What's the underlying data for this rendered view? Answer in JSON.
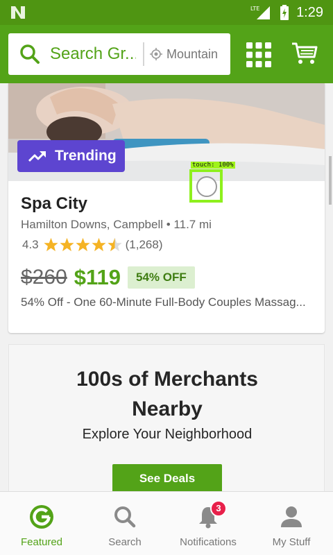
{
  "status_bar": {
    "network": "LTE",
    "time": "1:29"
  },
  "header": {
    "search_placeholder": "Search Gr...",
    "location": "Mountain"
  },
  "deal": {
    "badge": "Trending",
    "title": "Spa City",
    "location": "Hamilton Downs, Campbell • 11.7 mi",
    "rating": "4.3",
    "stars": 4.3,
    "review_count": "(1,268)",
    "old_price": "$260",
    "new_price": "$119",
    "discount": "54% OFF",
    "description": "54% Off - One 60-Minute Full-Body Couples Massag..."
  },
  "touch_overlay": {
    "label": "touch: 100%"
  },
  "merchants": {
    "heading_line1": "100s of Merchants",
    "heading_line2": "Nearby",
    "subheading": "Explore Your Neighborhood",
    "button": "See Deals"
  },
  "bottom_nav": {
    "items": [
      {
        "label": "Featured",
        "icon": "groupon-g-icon",
        "active": true
      },
      {
        "label": "Search",
        "icon": "search-icon",
        "active": false
      },
      {
        "label": "Notifications",
        "icon": "bell-icon",
        "active": false
      },
      {
        "label": "My Stuff",
        "icon": "person-icon",
        "active": false
      }
    ],
    "notification_count": "3"
  },
  "colors": {
    "brand_green": "#53a318",
    "status_green": "#4f9512",
    "trending_purple": "#5d45d0",
    "star_yellow": "#f5b324",
    "badge_red": "#e8204a",
    "touch_green": "#8ef01d"
  }
}
